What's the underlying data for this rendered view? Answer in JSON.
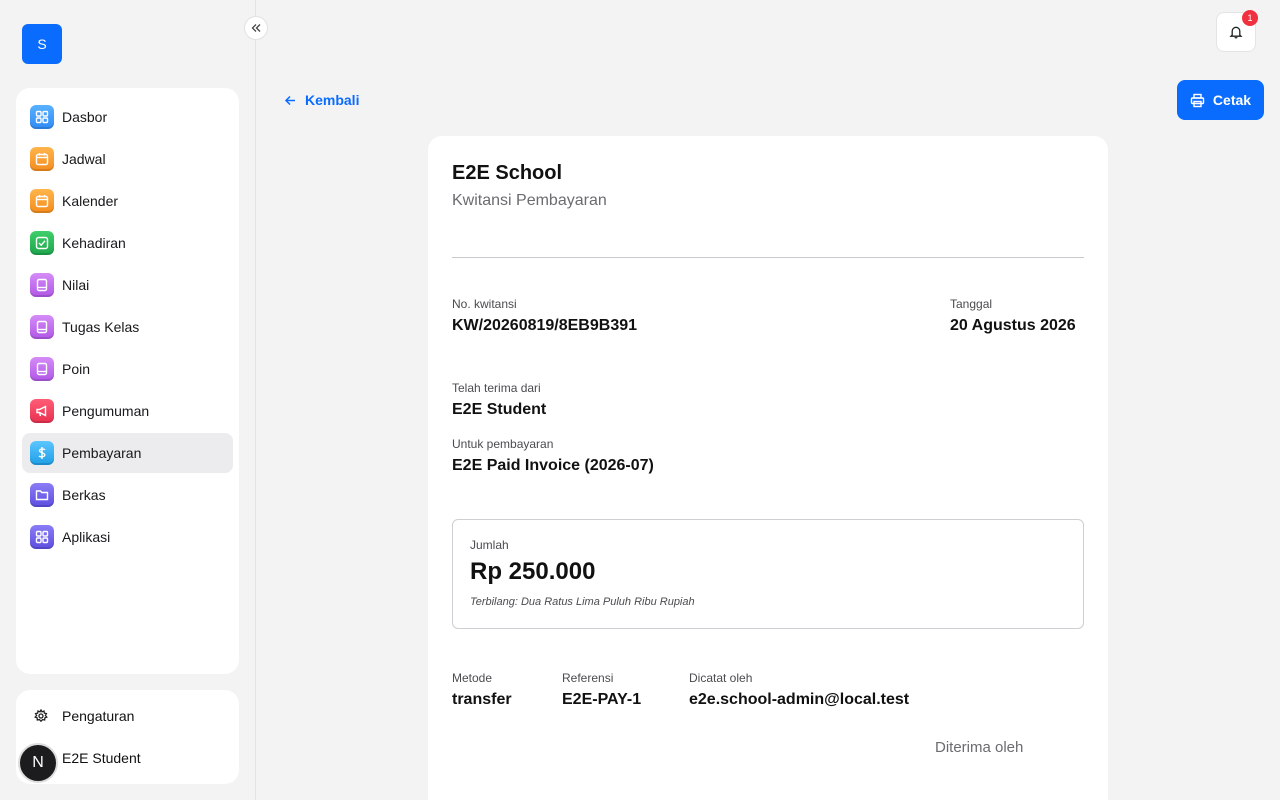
{
  "sidebar": {
    "logo_letter": "S",
    "items": [
      {
        "label": "Dasbor",
        "icon": "dashboard-icon",
        "color": "#3a99fa"
      },
      {
        "label": "Jadwal",
        "icon": "calendar-icon",
        "color": "#f7a23a"
      },
      {
        "label": "Kalender",
        "icon": "calendar-icon",
        "color": "#f7a23a"
      },
      {
        "label": "Kehadiran",
        "icon": "check-square-icon",
        "color": "#2bb95a"
      },
      {
        "label": "Nilai",
        "icon": "book-icon",
        "color": "#c274f0"
      },
      {
        "label": "Tugas Kelas",
        "icon": "book-icon",
        "color": "#c274f0"
      },
      {
        "label": "Poin",
        "icon": "book-icon",
        "color": "#c274f0"
      },
      {
        "label": "Pengumuman",
        "icon": "megaphone-icon",
        "color": "#f14763"
      },
      {
        "label": "Pembayaran",
        "icon": "dollar-icon",
        "color": "#33b2f0",
        "active": true
      },
      {
        "label": "Berkas",
        "icon": "folder-icon",
        "color": "#7264ea"
      },
      {
        "label": "Aplikasi",
        "icon": "apps-icon",
        "color": "#7264ea"
      }
    ],
    "settings_label": "Pengaturan",
    "user_name": "E2E Student",
    "avatar_letter": "N"
  },
  "header": {
    "notification_count": "1",
    "back_label": "Kembali",
    "print_label": "Cetak"
  },
  "receipt": {
    "school_name": "E2E School",
    "title": "Kwitansi Pembayaran",
    "number_label": "No. kwitansi",
    "number_value": "KW/20260819/8EB9B391",
    "date_label": "Tanggal",
    "date_value": "20 Agustus 2026",
    "received_from_label": "Telah terima dari",
    "received_from_value": "E2E Student",
    "for_payment_label": "Untuk pembayaran",
    "for_payment_value": "E2E Paid Invoice (2026-07)",
    "amount_label": "Jumlah",
    "amount_value": "Rp 250.000",
    "amount_words": "Terbilang: Dua Ratus Lima Puluh Ribu Rupiah",
    "method_label": "Metode",
    "method_value": "transfer",
    "reference_label": "Referensi",
    "reference_value": "E2E-PAY-1",
    "recorded_by_label": "Dicatat oleh",
    "recorded_by_value": "e2e.school-admin@local.test",
    "received_by_label": "Diterima oleh"
  },
  "colors": {
    "accent": "#0a6cff",
    "badge": "#f0303f"
  }
}
